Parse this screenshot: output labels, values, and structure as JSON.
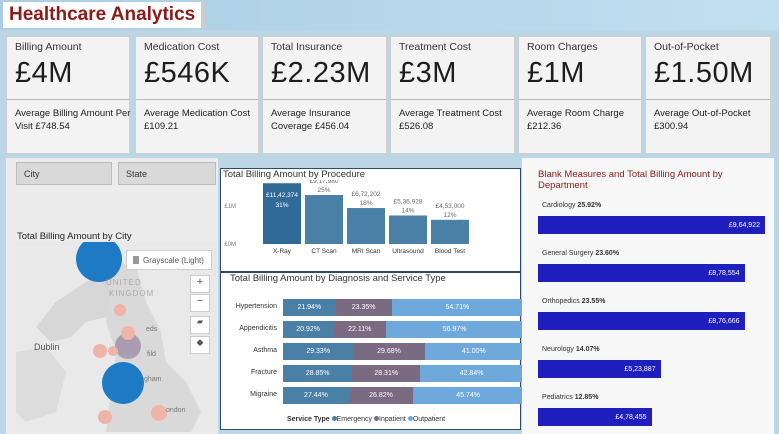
{
  "header": {
    "title": "Healthcare Analytics"
  },
  "kpis": [
    {
      "label": "Billing Amount",
      "value": "£4M",
      "sub": "Average Billing Amount Per Visit £748.54"
    },
    {
      "label": "Medication Cost",
      "value": "£546K",
      "sub": "Average Medication Cost £109.21"
    },
    {
      "label": "Total Insurance",
      "value": "£2.23M",
      "sub": "Average Insurance Coverage £456.04"
    },
    {
      "label": "Treatment Cost",
      "value": "£3M",
      "sub": "Average Treatment Cost £526.08"
    },
    {
      "label": "Room Charges",
      "value": "£1M",
      "sub": "Average Room Charge £212.36"
    },
    {
      "label": "Out-of-Pocket",
      "value": "£1.50M",
      "sub": "Average Out-of-Pocket £300.94"
    }
  ],
  "slicers": {
    "city": "City",
    "state": "State"
  },
  "map": {
    "title": "Total Billing Amount by City",
    "style_label": "Grayscale (Light)",
    "labels": {
      "uk": "UNITED",
      "kingdom": "KINGDOM",
      "dublin": "Dublin",
      "fild": "fild",
      "gham": "gham",
      "london": "ondon",
      "eds": "eds"
    }
  },
  "procedure_chart": {
    "title": "Total Billing Amount by Procedure",
    "ytick_top": "£1M",
    "ytick_bottom": "£0M",
    "bars": [
      {
        "cat": "X-Ray",
        "value": "£11,42,374",
        "pct": "31%",
        "frac": 0.98
      },
      {
        "cat": "CT Scan",
        "value": "£9,17,980",
        "pct": "25%",
        "frac": 0.79
      },
      {
        "cat": "MRI Scan",
        "value": "£6,72,202",
        "pct": "18%",
        "frac": 0.58
      },
      {
        "cat": "Ultrasound",
        "value": "£5,36,928",
        "pct": "14%",
        "frac": 0.46
      },
      {
        "cat": "Blood Test",
        "value": "£4,53,000",
        "pct": "12%",
        "frac": 0.39
      }
    ]
  },
  "diagnosis_chart": {
    "title": "Total Billing Amount by Diagnosis and Service Type",
    "legend_title": "Service Type",
    "legend": [
      "Emergency",
      "Inpatient",
      "Outpatient"
    ],
    "colors": {
      "Emergency": "#4a7fa6",
      "Inpatient": "#7a6a82",
      "Outpatient": "#6fa9db"
    },
    "rows": [
      {
        "cat": "Hypertension",
        "e": 21.94,
        "i": 23.35,
        "o": 54.71,
        "el": "21.94%",
        "il": "23.35%",
        "ol": "54.71%"
      },
      {
        "cat": "Appendicitis",
        "e": 20.92,
        "i": 22.11,
        "o": 56.97,
        "el": "20.92%",
        "il": "22.11%",
        "ol": "56.97%"
      },
      {
        "cat": "Asthma",
        "e": 29.33,
        "i": 29.68,
        "o": 41.0,
        "el": "29.33%",
        "il": "29.68%",
        "ol": "41.00%"
      },
      {
        "cat": "Fracture",
        "e": 28.85,
        "i": 28.31,
        "o": 42.84,
        "el": "28.85%",
        "il": "28.31%",
        "ol": "42.84%"
      },
      {
        "cat": "Migraine",
        "e": 27.44,
        "i": 26.82,
        "o": 45.74,
        "el": "27.44%",
        "il": "26.82%",
        "ol": "45.74%"
      }
    ]
  },
  "department_chart": {
    "title": "Blank Measures and Total Billing Amount by Department",
    "items": [
      {
        "dept": "Cardiology",
        "pct": "25.92%",
        "value": "£9,64,922",
        "frac": 1.0
      },
      {
        "dept": "General Surgery",
        "pct": "23.60%",
        "value": "£8,78,554",
        "frac": 0.91
      },
      {
        "dept": "Orthopedics",
        "pct": "23.55%",
        "value": "£8,76,666",
        "frac": 0.91
      },
      {
        "dept": "Neurology",
        "pct": "14.07%",
        "value": "£5,23,887",
        "frac": 0.54
      },
      {
        "dept": "Pediatrics",
        "pct": "12.85%",
        "value": "£4,78,455",
        "frac": 0.5
      }
    ]
  }
}
